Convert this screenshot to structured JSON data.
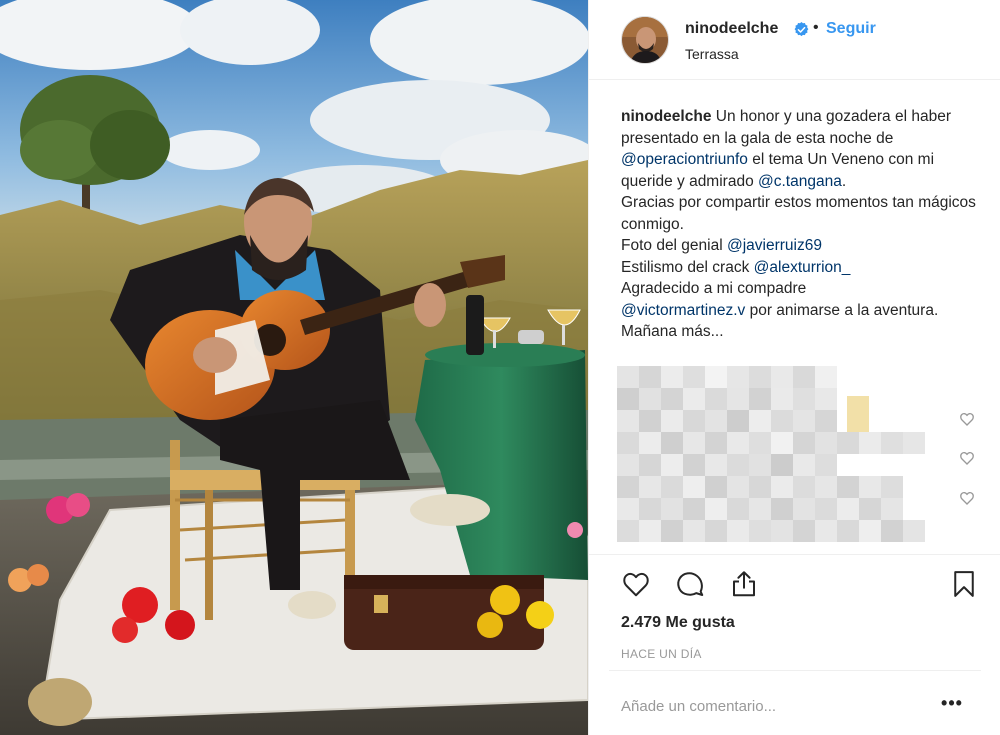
{
  "post": {
    "username": "ninodeelche",
    "verified": true,
    "separator": "•",
    "follow_label": "Seguir",
    "location": "Terrassa",
    "caption": {
      "username": "ninodeelche",
      "line1": " Un honor y una gozadera el haber presentado en la gala de esta noche de ",
      "mention1": "@operaciontriunfo",
      "line2": " el tema Un Veneno con mi queride y admirado ",
      "mention2": "@c.tangana",
      "line3": ".",
      "line4": "Gracias por compartir estos momentos tan mágicos conmigo.",
      "line5": "Foto del genial ",
      "mention3": "@javierruiz69",
      "line6": "Estilismo del crack ",
      "mention4": "@alexturrion_",
      "line7": "Agradecido a mi compadre ",
      "mention5": "@victormartinez.v",
      "line8": " por animarse a la aventura.",
      "line9": "Mañana más..."
    },
    "likes": "2.479 Me gusta",
    "time_ago": "HACE UN DÍA",
    "comment_placeholder": "Añade un comentario...",
    "more_label": "•••"
  },
  "icons": {
    "verified": "verified-badge-icon",
    "like": "heart-icon",
    "comment": "comment-icon",
    "share": "share-icon",
    "save": "bookmark-icon",
    "more": "more-options-icon"
  },
  "colors": {
    "accent": "#3897f0",
    "mention": "#003569",
    "text": "#262626",
    "muted": "#999999",
    "border": "#efefef"
  }
}
